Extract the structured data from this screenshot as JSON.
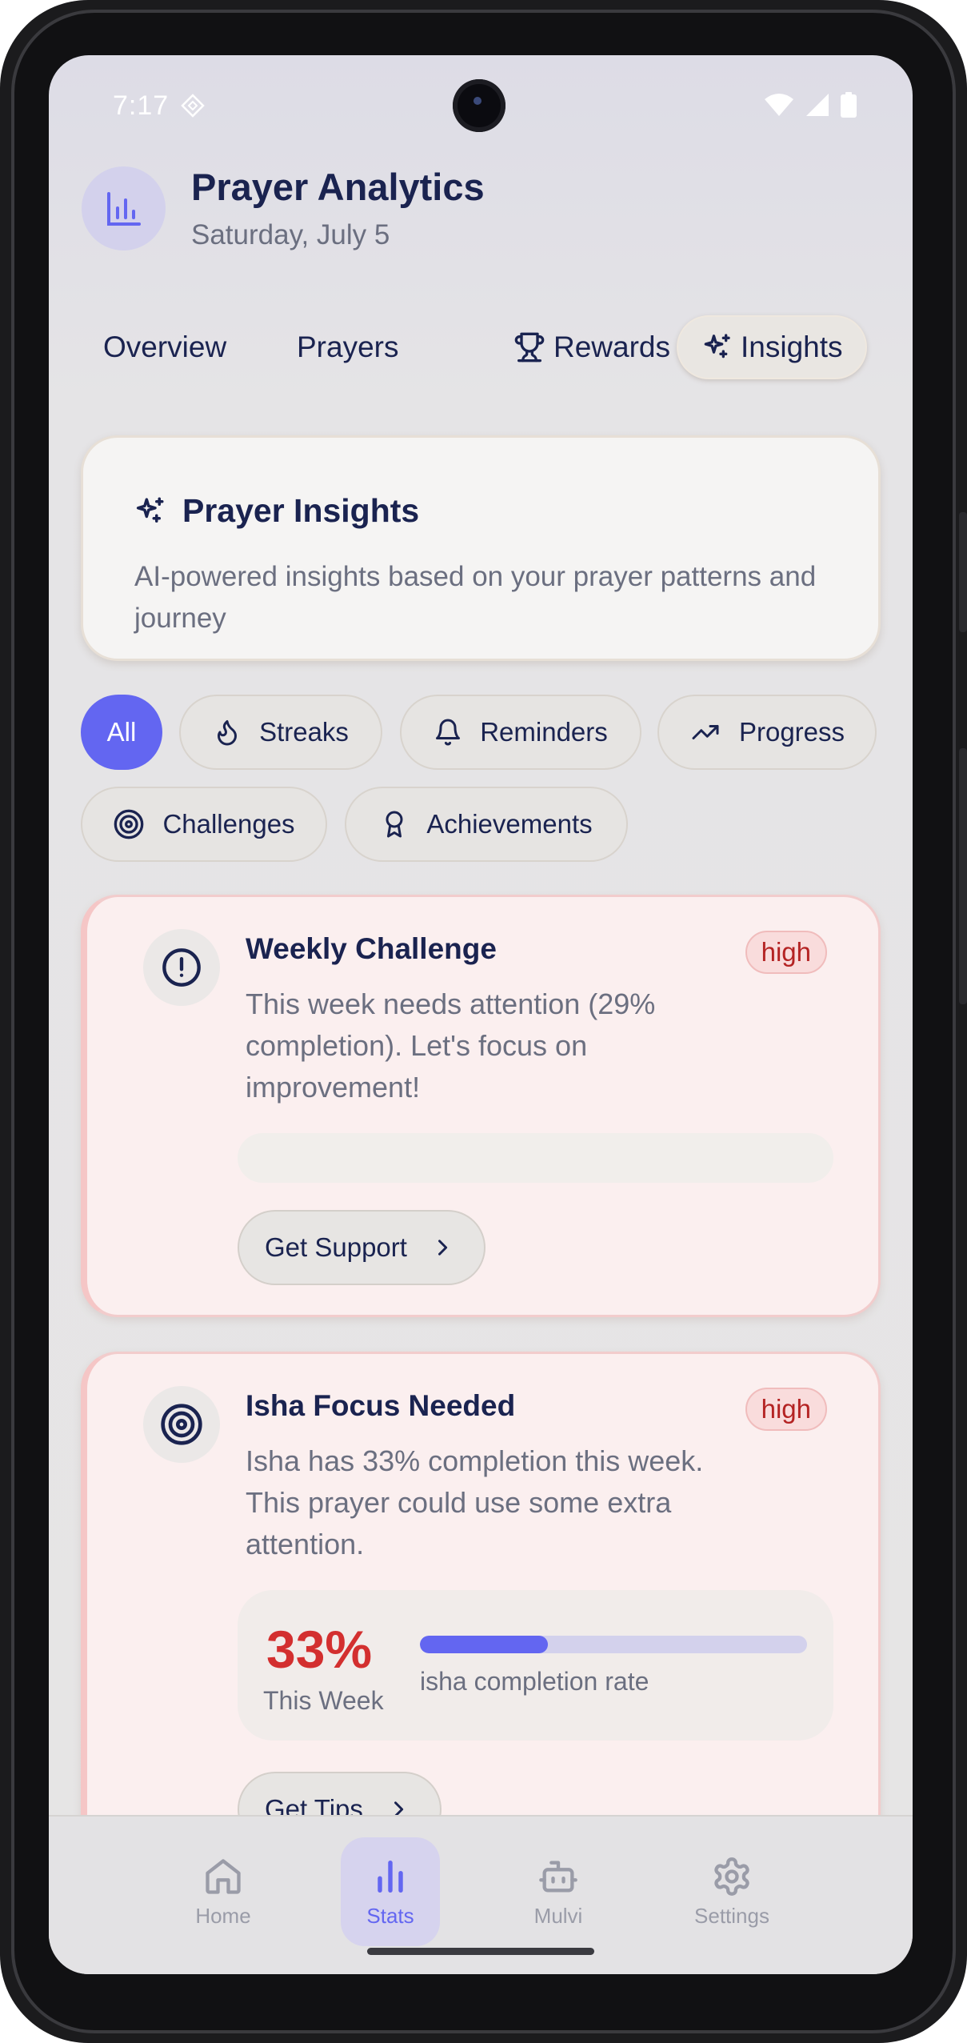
{
  "status_bar": {
    "time": "7:17"
  },
  "header": {
    "title": "Prayer Analytics",
    "date": "Saturday, July 5"
  },
  "tabs": [
    {
      "label": "Overview",
      "active": false
    },
    {
      "label": "Prayers",
      "active": false
    },
    {
      "label": "Rewards",
      "icon": "trophy-icon",
      "active": false
    },
    {
      "label": "Insights",
      "icon": "sparkles-icon",
      "active": true
    }
  ],
  "insights_card": {
    "title": "Prayer Insights",
    "description": "AI-powered insights based on your prayer patterns and journey"
  },
  "filters": [
    {
      "label": "All",
      "active": true
    },
    {
      "label": "Streaks",
      "icon": "flame-icon"
    },
    {
      "label": "Reminders",
      "icon": "bell-icon"
    },
    {
      "label": "Progress",
      "icon": "trending-up-icon"
    },
    {
      "label": "Challenges",
      "icon": "target-icon"
    },
    {
      "label": "Achievements",
      "icon": "award-icon"
    }
  ],
  "insight_cards": [
    {
      "title": "Weekly Challenge",
      "priority": "high",
      "icon": "alert-circle-icon",
      "description": "This week needs attention (29% completion). Let's focus on improvement!",
      "action_label": "Get Support"
    },
    {
      "title": "Isha Focus Needed",
      "priority": "high",
      "icon": "target-icon",
      "description": "Isha has 33% completion this week. This prayer could use some extra attention.",
      "stat_value": "33%",
      "stat_period": "This Week",
      "completion_fraction": 0.33,
      "stat_caption": "isha completion rate",
      "action_label": "Get Tips"
    }
  ],
  "bottom_nav": [
    {
      "label": "Home",
      "icon": "home-icon",
      "active": false
    },
    {
      "label": "Stats",
      "icon": "bar-chart-icon",
      "active": true
    },
    {
      "label": "Mulvi",
      "icon": "bot-icon",
      "active": false
    },
    {
      "label": "Settings",
      "icon": "gear-icon",
      "active": false
    }
  ],
  "colors": {
    "accent": "#6366f1",
    "title": "#1a2350",
    "muted": "#6b6f80",
    "danger": "#d32f2f",
    "card_alert_bg": "#fbefef"
  }
}
